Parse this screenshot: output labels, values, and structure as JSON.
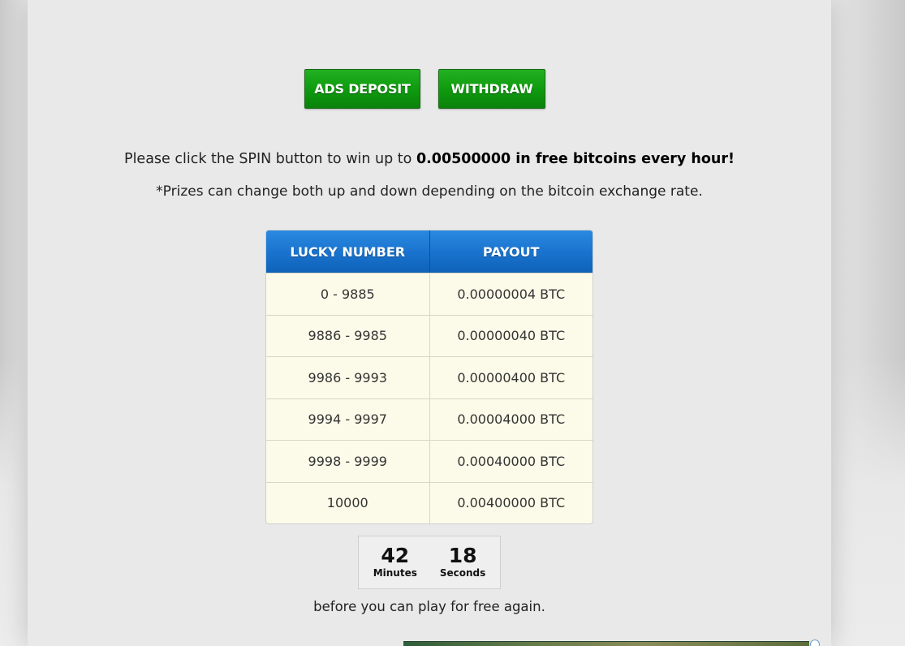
{
  "buttons": {
    "ads_deposit": "ADS DEPOSIT",
    "withdraw": "WITHDRAW"
  },
  "intro": {
    "prefix": "Please click the SPIN button to win up to ",
    "highlight": "0.00500000 in free bitcoins every hour!"
  },
  "note": "*Prizes can change both up and down depending on the bitcoin exchange rate.",
  "table": {
    "headers": [
      "LUCKY NUMBER",
      "PAYOUT"
    ],
    "rows": [
      {
        "range": "0 - 9885",
        "payout": "0.00000004 BTC"
      },
      {
        "range": "9886 - 9985",
        "payout": "0.00000040 BTC"
      },
      {
        "range": "9986 - 9993",
        "payout": "0.00000400 BTC"
      },
      {
        "range": "9994 - 9997",
        "payout": "0.00004000 BTC"
      },
      {
        "range": "9998 - 9999",
        "payout": "0.00040000 BTC"
      },
      {
        "range": "10000",
        "payout": "0.00400000 BTC"
      }
    ]
  },
  "countdown": {
    "minutes": "42",
    "minutes_label": "Minutes",
    "seconds": "18",
    "seconds_label": "Seconds"
  },
  "wait_text": "before you can play for free again.",
  "colors": {
    "button_green": "#109c10",
    "header_blue": "#1a74cf",
    "table_cell_bg": "#fcfbe9"
  }
}
